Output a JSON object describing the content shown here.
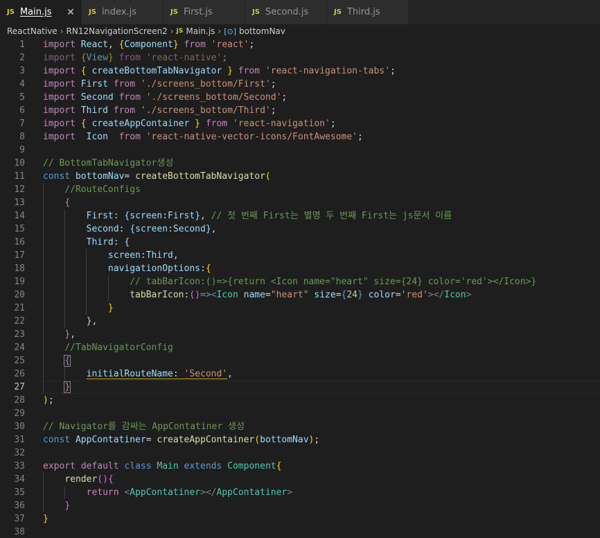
{
  "tabs": [
    {
      "label": "Main.js",
      "active": true,
      "badge": "JS",
      "close": "✕"
    },
    {
      "label": "index.js",
      "active": false,
      "badge": "JS"
    },
    {
      "label": "First.js",
      "active": false,
      "badge": "JS"
    },
    {
      "label": "Second.js",
      "active": false,
      "badge": "JS"
    },
    {
      "label": "Third.js",
      "active": false,
      "badge": "JS"
    }
  ],
  "breadcrumb": {
    "root": "ReactNative",
    "folder": "RN12NavigationScreen2",
    "file": "Main.js",
    "file_badge": "JS",
    "symbol": "bottomNav",
    "symbol_icon": "[⊙]"
  },
  "editor": {
    "current_line": 27,
    "lines": [
      [
        [
          "k",
          "import"
        ],
        [
          "p",
          " "
        ],
        [
          "v",
          "React"
        ],
        [
          "p",
          ", "
        ],
        [
          "y",
          "{"
        ],
        [
          "v",
          "Component"
        ],
        [
          "y",
          "}"
        ],
        [
          "p",
          " "
        ],
        [
          "k",
          "from"
        ],
        [
          "p",
          " "
        ],
        [
          "s",
          "'react'"
        ],
        [
          "p",
          ";"
        ]
      ],
      [
        [
          "k dim",
          "import"
        ],
        [
          "p dim",
          " "
        ],
        [
          "y dim",
          "{"
        ],
        [
          "v dim",
          "View"
        ],
        [
          "y dim",
          "}"
        ],
        [
          "p dim",
          " "
        ],
        [
          "k dim",
          "from"
        ],
        [
          "p dim",
          " "
        ],
        [
          "s dim",
          "'react-native'"
        ],
        [
          "p dim",
          ";"
        ]
      ],
      [
        [
          "k",
          "import"
        ],
        [
          "p",
          " "
        ],
        [
          "y",
          "{"
        ],
        [
          "p",
          " "
        ],
        [
          "v",
          "createBottomTabNavigator"
        ],
        [
          "p",
          " "
        ],
        [
          "y",
          "}"
        ],
        [
          "p",
          " "
        ],
        [
          "k",
          "from"
        ],
        [
          "p",
          " "
        ],
        [
          "s",
          "'react-navigation-tabs'"
        ],
        [
          "p",
          ";"
        ]
      ],
      [
        [
          "k",
          "import"
        ],
        [
          "p",
          " "
        ],
        [
          "v",
          "First"
        ],
        [
          "p",
          " "
        ],
        [
          "k",
          "from"
        ],
        [
          "p",
          " "
        ],
        [
          "s",
          "'./screens_bottom/First'"
        ],
        [
          "p",
          ";"
        ]
      ],
      [
        [
          "k",
          "import"
        ],
        [
          "p",
          " "
        ],
        [
          "v",
          "Second"
        ],
        [
          "p",
          " "
        ],
        [
          "k",
          "from"
        ],
        [
          "p",
          " "
        ],
        [
          "s",
          "'./screens_bottom/Second'"
        ],
        [
          "p",
          ";"
        ]
      ],
      [
        [
          "k",
          "import"
        ],
        [
          "p",
          " "
        ],
        [
          "v",
          "Third"
        ],
        [
          "p",
          " "
        ],
        [
          "k",
          "from"
        ],
        [
          "p",
          " "
        ],
        [
          "s",
          "'./screens_bottom/Third'"
        ],
        [
          "p",
          ";"
        ]
      ],
      [
        [
          "k",
          "import"
        ],
        [
          "p",
          " "
        ],
        [
          "y",
          "{"
        ],
        [
          "p",
          " "
        ],
        [
          "v",
          "createAppContainer"
        ],
        [
          "p",
          " "
        ],
        [
          "y",
          "}"
        ],
        [
          "p",
          " "
        ],
        [
          "k",
          "from"
        ],
        [
          "p",
          " "
        ],
        [
          "s",
          "'react-navigation'"
        ],
        [
          "p",
          ";"
        ]
      ],
      [
        [
          "k",
          "import"
        ],
        [
          "p",
          "  "
        ],
        [
          "v",
          "Icon"
        ],
        [
          "p",
          "  "
        ],
        [
          "k",
          "from"
        ],
        [
          "p",
          " "
        ],
        [
          "s",
          "'react-native-vector-icons/FontAwesome'"
        ],
        [
          "p",
          ";"
        ]
      ],
      [],
      [
        [
          "c",
          "// BottomTabNavigator생성"
        ]
      ],
      [
        [
          "b",
          "const"
        ],
        [
          "p",
          " "
        ],
        [
          "v",
          "bottomNav"
        ],
        [
          "p",
          "= "
        ],
        [
          "f",
          "createBottomTabNavigator"
        ],
        [
          "y",
          "("
        ]
      ],
      [
        [
          "p",
          "    "
        ],
        [
          "c",
          "//RouteConfigs"
        ]
      ],
      [
        [
          "p",
          "    "
        ],
        [
          "m",
          "{"
        ]
      ],
      [
        [
          "p",
          "        "
        ],
        [
          "v",
          "First"
        ],
        [
          "p",
          ": "
        ],
        [
          "v",
          "{"
        ],
        [
          "v",
          "screen"
        ],
        [
          "p",
          ":"
        ],
        [
          "v",
          "First"
        ],
        [
          "v",
          "}"
        ],
        [
          "p",
          ", "
        ],
        [
          "c",
          "// 첫 번째 First는 별명 두 번째 First는 js문서 이름"
        ]
      ],
      [
        [
          "p",
          "        "
        ],
        [
          "v",
          "Second"
        ],
        [
          "p",
          ": "
        ],
        [
          "v",
          "{"
        ],
        [
          "v",
          "screen"
        ],
        [
          "p",
          ":"
        ],
        [
          "v",
          "Second"
        ],
        [
          "v",
          "}"
        ],
        [
          "p",
          ","
        ]
      ],
      [
        [
          "p",
          "        "
        ],
        [
          "v",
          "Third"
        ],
        [
          "p",
          ": "
        ],
        [
          "v",
          "{"
        ]
      ],
      [
        [
          "p",
          "            "
        ],
        [
          "v",
          "screen"
        ],
        [
          "p",
          ":"
        ],
        [
          "v",
          "Third"
        ],
        [
          "p",
          ","
        ]
      ],
      [
        [
          "p",
          "            "
        ],
        [
          "v",
          "navigationOptions"
        ],
        [
          "p",
          ":"
        ],
        [
          "y",
          "{"
        ]
      ],
      [
        [
          "p",
          "                "
        ],
        [
          "c",
          "// tabBarIcon:()=>{return <Icon name=\"heart\" size={24} color='red'></Icon>}"
        ]
      ],
      [
        [
          "p",
          "                "
        ],
        [
          "f",
          "tabBarIcon"
        ],
        [
          "p",
          ":"
        ],
        [
          "m",
          "()"
        ],
        [
          "b",
          "=>"
        ],
        [
          "g",
          "<"
        ],
        [
          "t",
          "Icon"
        ],
        [
          "p",
          " "
        ],
        [
          "v",
          "name"
        ],
        [
          "p",
          "="
        ],
        [
          "s",
          "\"heart\""
        ],
        [
          "p",
          " "
        ],
        [
          "v",
          "size"
        ],
        [
          "p",
          "="
        ],
        [
          "b",
          "{"
        ],
        [
          "n",
          "24"
        ],
        [
          "b",
          "}"
        ],
        [
          "p",
          " "
        ],
        [
          "v",
          "color"
        ],
        [
          "p",
          "="
        ],
        [
          "s",
          "'red'"
        ],
        [
          "g",
          ">"
        ],
        [
          "g",
          "</"
        ],
        [
          "t",
          "Icon"
        ],
        [
          "g",
          ">"
        ]
      ],
      [
        [
          "p",
          "            "
        ],
        [
          "y",
          "}"
        ]
      ],
      [
        [
          "p",
          "        "
        ],
        [
          "v",
          "}"
        ],
        [
          "p",
          ","
        ]
      ],
      [
        [
          "p",
          "    "
        ],
        [
          "m",
          "}"
        ],
        [
          "p",
          ","
        ]
      ],
      [
        [
          "p",
          "    "
        ],
        [
          "c",
          "//TabNavigatorConfig"
        ]
      ],
      [
        [
          "p",
          "    "
        ],
        [
          "m bracket-box",
          "{"
        ]
      ],
      [
        [
          "p",
          "        "
        ],
        [
          "v warn",
          "initialRouteName"
        ],
        [
          "p warn",
          ": "
        ],
        [
          "s warn",
          "'Second'"
        ],
        [
          "p",
          ","
        ]
      ],
      [
        [
          "p",
          "    "
        ],
        [
          "m bracket-box",
          "}"
        ]
      ],
      [
        [
          "y",
          ")"
        ],
        [
          "p",
          ";"
        ]
      ],
      [],
      [
        [
          "c",
          "// Navigator를 감싸는 AppContatiner 생성"
        ]
      ],
      [
        [
          "b",
          "const"
        ],
        [
          "p",
          " "
        ],
        [
          "v",
          "AppContatiner"
        ],
        [
          "p",
          "= "
        ],
        [
          "f",
          "createAppContainer"
        ],
        [
          "y",
          "("
        ],
        [
          "v",
          "bottomNav"
        ],
        [
          "y",
          ")"
        ],
        [
          "p",
          ";"
        ]
      ],
      [],
      [
        [
          "k",
          "export"
        ],
        [
          "p",
          " "
        ],
        [
          "k",
          "default"
        ],
        [
          "p",
          " "
        ],
        [
          "b",
          "class"
        ],
        [
          "p",
          " "
        ],
        [
          "t",
          "Main"
        ],
        [
          "p",
          " "
        ],
        [
          "b",
          "extends"
        ],
        [
          "p",
          " "
        ],
        [
          "t",
          "Component"
        ],
        [
          "y",
          "{"
        ]
      ],
      [
        [
          "p",
          "    "
        ],
        [
          "f",
          "render"
        ],
        [
          "m",
          "()"
        ],
        [
          "m",
          "{"
        ]
      ],
      [
        [
          "p",
          "        "
        ],
        [
          "k",
          "return"
        ],
        [
          "p",
          " "
        ],
        [
          "g",
          "<"
        ],
        [
          "t",
          "AppContatiner"
        ],
        [
          "g",
          ">"
        ],
        [
          "g",
          "</"
        ],
        [
          "t",
          "AppContatiner"
        ],
        [
          "g",
          ">"
        ]
      ],
      [
        [
          "p",
          "    "
        ],
        [
          "m",
          "}"
        ]
      ],
      [
        [
          "y",
          "}"
        ]
      ],
      []
    ],
    "guides": [
      {
        "from": 12,
        "to": 27,
        "col": 0
      },
      {
        "from": 14,
        "to": 22,
        "col": 1
      },
      {
        "from": 17,
        "to": 21,
        "col": 2
      },
      {
        "from": 19,
        "to": 20,
        "col": 3
      },
      {
        "from": 34,
        "to": 36,
        "col": 0
      },
      {
        "from": 35,
        "to": 35,
        "col": 1
      },
      {
        "from": 26,
        "to": 26,
        "col": 1
      }
    ]
  }
}
